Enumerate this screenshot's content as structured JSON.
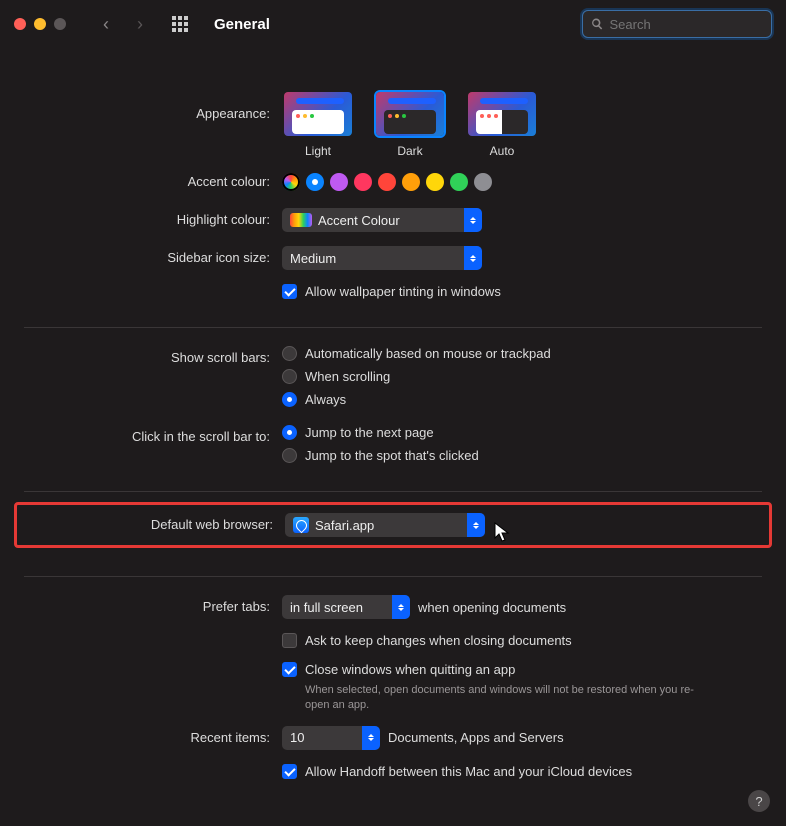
{
  "titlebar": {
    "title": "General",
    "search_placeholder": "Search"
  },
  "appearance": {
    "label": "Appearance:",
    "options": {
      "light": "Light",
      "dark": "Dark",
      "auto": "Auto"
    },
    "selected": "dark"
  },
  "accent": {
    "label": "Accent colour:",
    "colors": [
      "multi",
      "#0a84ff",
      "#bf5af2",
      "#ff375f",
      "#ff453a",
      "#ff9f0a",
      "#ffd60a",
      "#30d158",
      "#8e8e93"
    ],
    "selected_index": 1
  },
  "highlight": {
    "label": "Highlight colour:",
    "value": "Accent Colour"
  },
  "sidebar_size": {
    "label": "Sidebar icon size:",
    "value": "Medium"
  },
  "wallpaper_tint": {
    "label": "Allow wallpaper tinting in windows",
    "checked": true
  },
  "scrollbars": {
    "label": "Show scroll bars:",
    "options": {
      "auto": "Automatically based on mouse or trackpad",
      "scrolling": "When scrolling",
      "always": "Always"
    },
    "selected": "always"
  },
  "click_scroll": {
    "label": "Click in the scroll bar to:",
    "options": {
      "next": "Jump to the next page",
      "spot": "Jump to the spot that's clicked"
    },
    "selected": "next"
  },
  "default_browser": {
    "label": "Default web browser:",
    "value": "Safari.app"
  },
  "prefer_tabs": {
    "label": "Prefer tabs:",
    "value": "in full screen",
    "suffix": "when opening documents"
  },
  "ask_changes": {
    "label": "Ask to keep changes when closing documents",
    "checked": false
  },
  "close_windows": {
    "label": "Close windows when quitting an app",
    "checked": true,
    "sub": "When selected, open documents and windows will not be restored when you re-open an app."
  },
  "recent": {
    "label": "Recent items:",
    "value": "10",
    "suffix": "Documents, Apps and Servers"
  },
  "handoff": {
    "label": "Allow Handoff between this Mac and your iCloud devices",
    "checked": true
  },
  "help": "?"
}
